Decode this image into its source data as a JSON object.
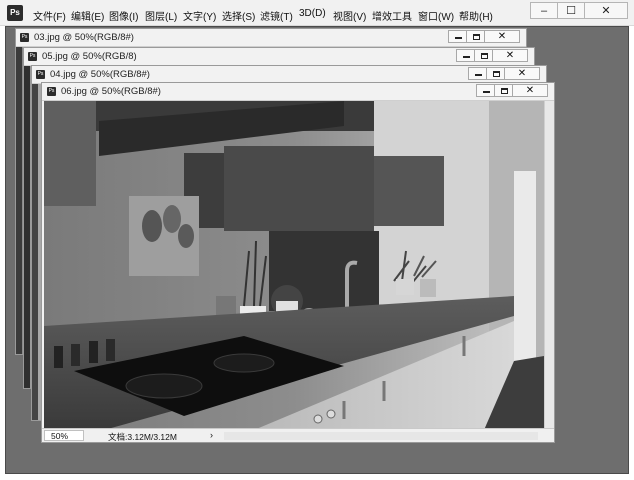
{
  "app": {
    "logo": "Ps"
  },
  "menu": [
    {
      "label": "文件(F)"
    },
    {
      "label": "编辑(E)"
    },
    {
      "label": "图像(I)"
    },
    {
      "label": "图层(L)"
    },
    {
      "label": "文字(Y)"
    },
    {
      "label": "选择(S)"
    },
    {
      "label": "滤镜(T)"
    },
    {
      "label": "3D(D)"
    },
    {
      "label": "视图(V)"
    },
    {
      "label": "增效工具"
    },
    {
      "label": "窗口(W)"
    },
    {
      "label": "帮助(H)"
    }
  ],
  "window_controls": {
    "minimize": "–",
    "maximize": "☐",
    "close": "✕"
  },
  "documents": [
    {
      "title": "03.jpg @ 50%(RGB/8#)"
    },
    {
      "title": "05.jpg @ 50%(RGB/8)"
    },
    {
      "title": "04.jpg @ 50%(RGB/8#)"
    },
    {
      "title": "06.jpg @ 50%(RGB/8#)"
    }
  ],
  "status": {
    "zoom": "50%",
    "doc_info": "文档:3.12M/3.12M",
    "arrow": "›"
  },
  "icons": {
    "app_logo": "photoshop-logo-icon",
    "doc": "document-icon"
  }
}
